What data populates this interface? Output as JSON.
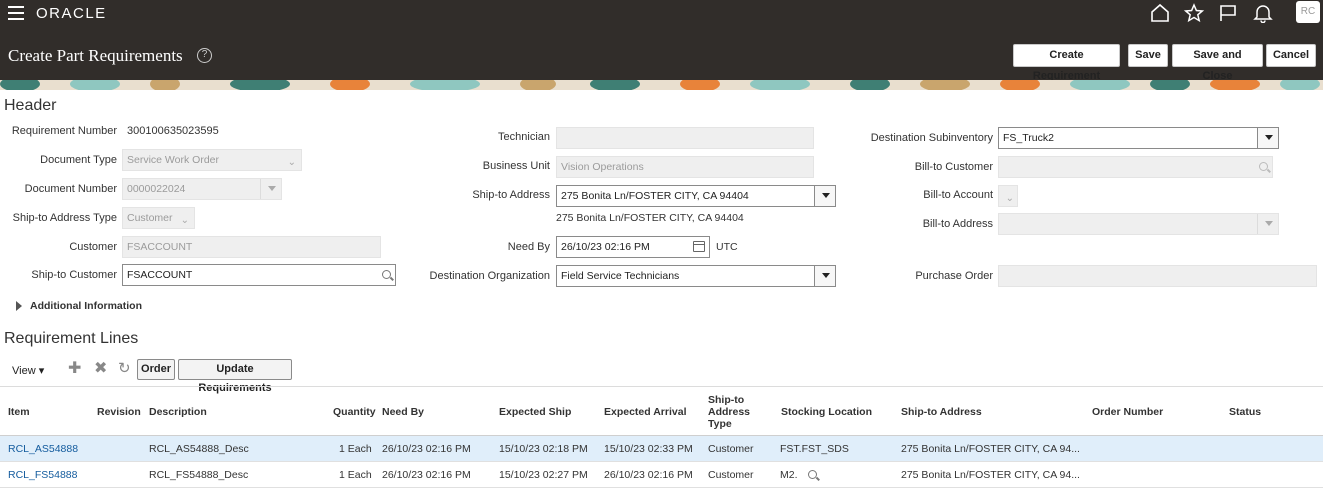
{
  "brand": {
    "logo": "ORACLE",
    "avatar_initials": "RC"
  },
  "icons": [
    "hamburger-icon",
    "home-icon",
    "star-icon",
    "flag-icon",
    "bell-icon",
    "help-icon",
    "search-icon",
    "calendar-icon",
    "add-icon",
    "delete-icon",
    "refresh-icon"
  ],
  "page": {
    "title": "Create Part Requirements",
    "buttons": {
      "create_requirement": "Create Requirement",
      "save": "Save",
      "save_and_close": "Save and Close",
      "cancel": "Cancel"
    }
  },
  "header": {
    "section_title": "Header",
    "requirement_number": {
      "label": "Requirement Number",
      "value": "300100635023595"
    },
    "document_type": {
      "label": "Document Type",
      "value": "Service Work Order"
    },
    "document_number": {
      "label": "Document Number",
      "value": "0000022024"
    },
    "ship_to_address_type": {
      "label": "Ship-to Address Type",
      "value": "Customer"
    },
    "customer": {
      "label": "Customer",
      "value": "FSACCOUNT"
    },
    "ship_to_customer": {
      "label": "Ship-to Customer",
      "value": "FSACCOUNT"
    },
    "technician": {
      "label": "Technician",
      "value": ""
    },
    "business_unit": {
      "label": "Business Unit",
      "value": "Vision Operations"
    },
    "ship_to_address": {
      "label": "Ship-to Address",
      "value": "275 Bonita Ln/FOSTER CITY, CA 94404",
      "display": "275 Bonita Ln/FOSTER CITY, CA 94404"
    },
    "need_by": {
      "label": "Need By",
      "value": "26/10/23 02:16 PM",
      "timezone": "UTC"
    },
    "destination_organization": {
      "label": "Destination Organization",
      "value": "Field Service Technicians"
    },
    "destination_subinventory": {
      "label": "Destination Subinventory",
      "value": "FS_Truck2"
    },
    "bill_to_customer": {
      "label": "Bill-to Customer",
      "value": ""
    },
    "bill_to_account": {
      "label": "Bill-to Account",
      "value": ""
    },
    "bill_to_address": {
      "label": "Bill-to Address",
      "value": ""
    },
    "purchase_order": {
      "label": "Purchase Order",
      "value": ""
    },
    "additional_information": "Additional Information"
  },
  "lines": {
    "section_title": "Requirement Lines",
    "toolbar": {
      "view": "View ▾",
      "order": "Order",
      "update": "Update Requirements"
    },
    "columns": [
      "Item",
      "Revision",
      "Description",
      "Quantity",
      "Need By",
      "Expected Ship",
      "Expected Arrival",
      "Ship-to Address Type",
      "Stocking Location",
      "Ship-to Address",
      "Order Number",
      "Status"
    ],
    "rows": [
      {
        "item": "RCL_AS54888",
        "revision": "",
        "description": "RCL_AS54888_Desc",
        "quantity": "1 Each",
        "need_by": "26/10/23 02:16 PM",
        "expected_ship": "15/10/23 02:18 PM",
        "expected_arrival": "15/10/23 02:33 PM",
        "ship_to_type": "Customer",
        "stocking_location": "FST.FST_SDS",
        "ship_to_address": "275 Bonita Ln/FOSTER CITY, CA 94...",
        "order_number": "",
        "status": ""
      },
      {
        "item": "RCL_FS54888",
        "revision": "",
        "description": "RCL_FS54888_Desc",
        "quantity": "1 Each",
        "need_by": "26/10/23 02:16 PM",
        "expected_ship": "15/10/23 02:27 PM",
        "expected_arrival": "26/10/23 02:16 PM",
        "ship_to_type": "Customer",
        "stocking_location": "M2.",
        "ship_to_address": "275 Bonita Ln/FOSTER CITY, CA 94...",
        "order_number": "",
        "status": ""
      }
    ]
  }
}
